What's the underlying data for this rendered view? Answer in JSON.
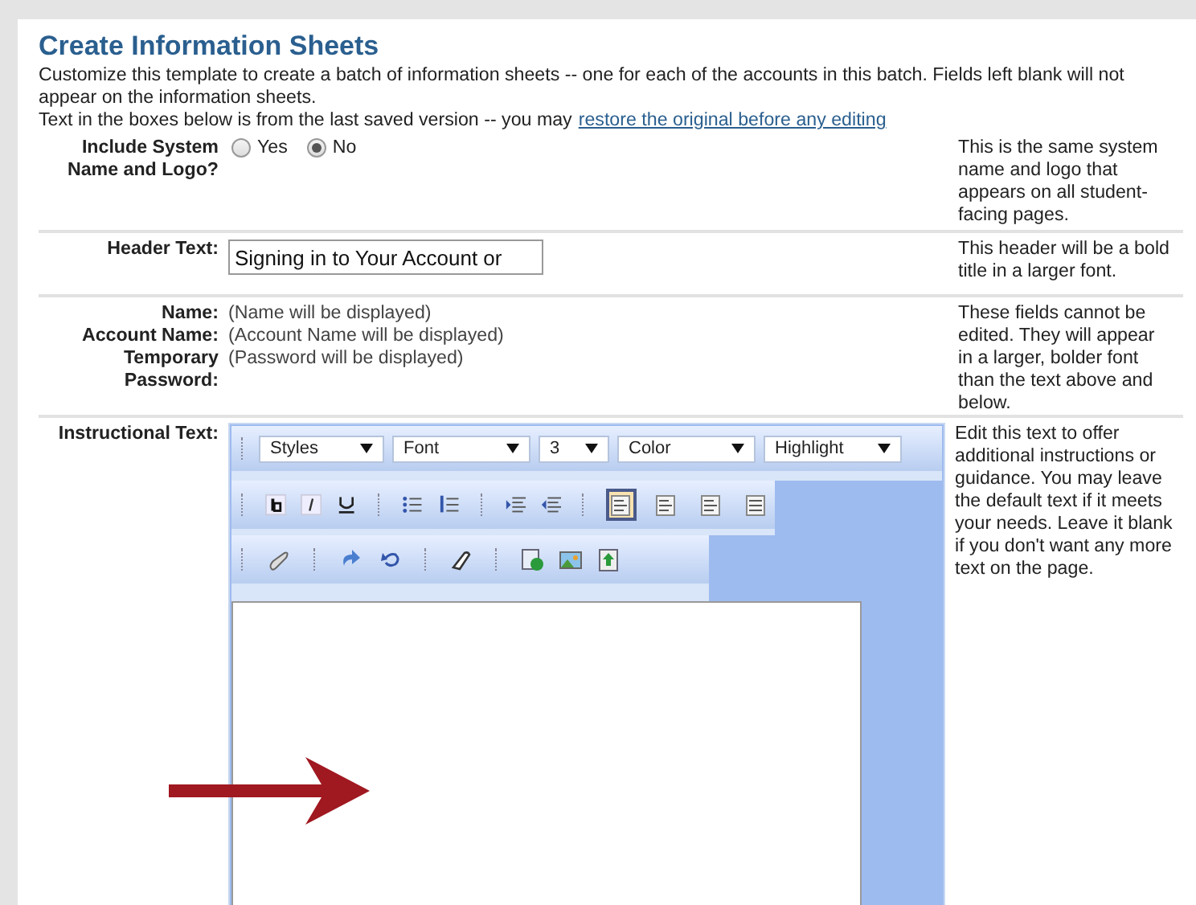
{
  "title": "Create Information Sheets",
  "intro": "Customize this template to create a batch of information sheets -- one for each of the accounts in this batch. Fields left blank will not appear on the information sheets.",
  "note": {
    "text": "Text in the boxes below is from the last saved version -- you may",
    "link": "restore the original before any editing"
  },
  "rows": [
    {
      "kind": "radio",
      "label": "Include System Name and Logo?",
      "options": [
        {
          "label": "Yes",
          "selected": false
        },
        {
          "label": "No",
          "selected": true
        }
      ],
      "help": "This is the same system name and logo that appears on all student-facing pages."
    },
    {
      "kind": "input",
      "label": "Header Text:",
      "value": "Signing in to Your Account or",
      "help": "This header will be a bold title in a larger font."
    },
    {
      "kind": "fields",
      "fields": [
        {
          "label": "Name:",
          "value": "(Name will be displayed)"
        },
        {
          "label": "Account Name:",
          "value": "(Account Name will be displayed)"
        },
        {
          "label": "Temporary Password:",
          "value": "(Password will be displayed)"
        }
      ],
      "help": "These fields cannot be edited. They will appear in a larger, bolder font than the text above and below."
    },
    {
      "kind": "editor",
      "label": "Instructional Text:",
      "dropdowns": [
        "Styles",
        "Font",
        "3",
        "Color",
        "Highlight"
      ],
      "align": [
        {
          "selected": true
        },
        {
          "selected": false
        },
        {
          "selected": false
        },
        {
          "selected": false
        }
      ],
      "help": "Edit this text to offer additional instructions or guidance. You may leave the default text if it meets your needs. Leave it blank if you don't want any more text on the page."
    }
  ]
}
